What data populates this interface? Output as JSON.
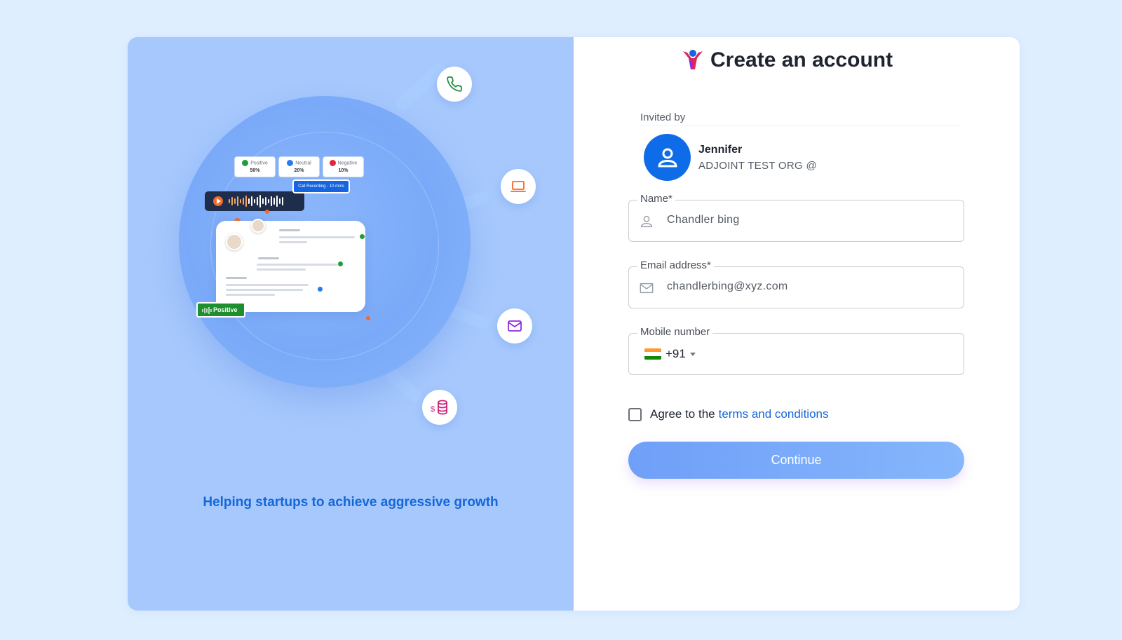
{
  "left_panel": {
    "stats": [
      {
        "label": "Positive",
        "value": "50%",
        "color": "#1e9e3a"
      },
      {
        "label": "Neutral",
        "value": "20%",
        "color": "#2b7bf0"
      },
      {
        "label": "Negative",
        "value": "10%",
        "color": "#e2263b"
      }
    ],
    "recording_label": "Call Recording - 10 mins",
    "positive_badge": "Positive",
    "tagline": "Helping startups to achieve aggressive growth",
    "float_icons": [
      "phone-icon",
      "laptop-icon",
      "mail-icon",
      "money-icon"
    ]
  },
  "header": {
    "title": "Create an account",
    "logo": "adjoint-logo-icon"
  },
  "invite": {
    "label": "Invited by",
    "name": "Jennifer",
    "org": "ADJOINT TEST ORG @"
  },
  "form": {
    "name": {
      "label": "Name*",
      "value": "Chandler bing"
    },
    "email": {
      "label": "Email address*",
      "value": "chandlerbing@xyz.com"
    },
    "mobile": {
      "label": "Mobile number",
      "dial_code": "+91",
      "country": "India",
      "value": ""
    },
    "agree_prefix": "Agree to the",
    "terms_link": "terms and conditions",
    "agree_checked": false,
    "submit_label": "Continue"
  },
  "colors": {
    "page_bg": "#deeeff",
    "left_panel_bg": "#a6c8fd",
    "accent": "#1567d8",
    "avatar_bg": "#0f6ce8"
  }
}
